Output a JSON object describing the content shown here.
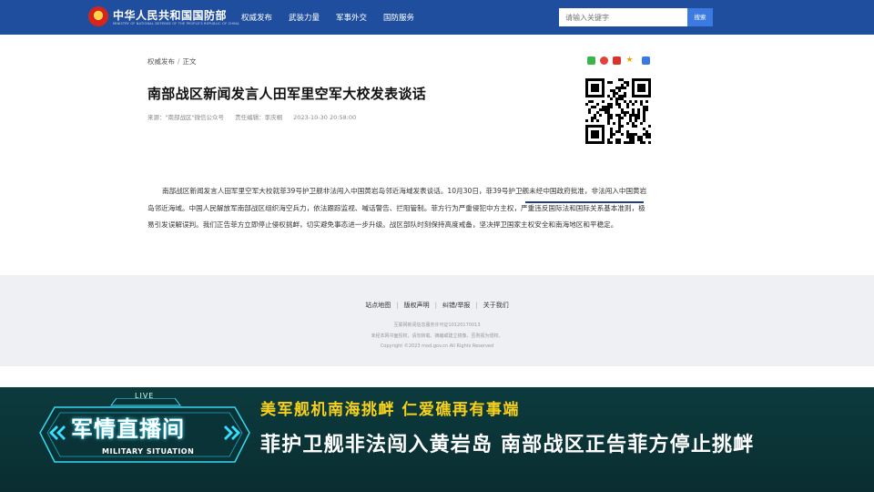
{
  "header": {
    "site_name": "中华人民共和国国防部",
    "site_sub": "MINISTRY OF NATIONAL DEFENSE OF THE PEOPLE'S REPUBLIC OF CHINA",
    "nav": [
      "权威发布",
      "武装力量",
      "军事外交",
      "国防服务"
    ],
    "search_placeholder": "请输入关键字",
    "search_button": "搜索"
  },
  "breadcrumb": {
    "section": "权威发布",
    "current": "正文"
  },
  "article": {
    "title": "南部战区新闻发言人田军里空军大校发表谈话",
    "source": "来源：\"南部战区\"微信公众号",
    "editor": "责任编辑：李庆桐",
    "datetime": "2023-10-30 20:58:00",
    "body": "南部战区新闻发言人田军里空军大校就菲39号护卫舰非法闯入中国黄岩岛邻近海域发表谈话。10月30日，菲39号护卫舰未经中国政府批准，非法闯入中国黄岩岛邻近海域。中国人民解放军南部战区组织海空兵力，依法跟踪监视、喊话警告、拦阻管制。菲方行为严重侵犯中方主权，严重违反国际法和国际关系基本准则，极易引发误解误判。我们正告菲方立即停止侵权挑衅，切实避免事态进一步升级。战区部队时刻保持高度戒备，坚决捍卫国家主权安全和南海地区和平稳定。"
  },
  "footer": {
    "links": [
      "站点地图",
      "版权声明",
      "纠错/举报",
      "关于我们"
    ],
    "icp": "互联网新闻信息服务许可证10120170013",
    "notice": "未经本网书面授权，请勿转载、摘编或建立镜像，否则视为侵权。",
    "copyright": "Copyright ©2023 mod.gov.cn All Rights Reserved"
  },
  "banner": {
    "live": "LIVE",
    "program_title": "军情直播间",
    "program_sub": "MILITARY SITUATION",
    "headline_top": "美军舰机南海挑衅  仁爱礁再有事端",
    "headline_main": "菲护卫舰非法闯入黄岩岛  南部战区正告菲方停止挑衅"
  },
  "colors": {
    "header_blue": "#1f4e9e",
    "banner_teal": "#0c3b3d",
    "headline_yellow": "#f6d01a",
    "glow_cyan": "#36e0ff"
  },
  "icons": [
    "national-emblem-icon",
    "wechat-share-icon",
    "weibo-share-icon",
    "pdf-icon",
    "favorite-star-icon",
    "more-share-icon",
    "qr-code"
  ]
}
